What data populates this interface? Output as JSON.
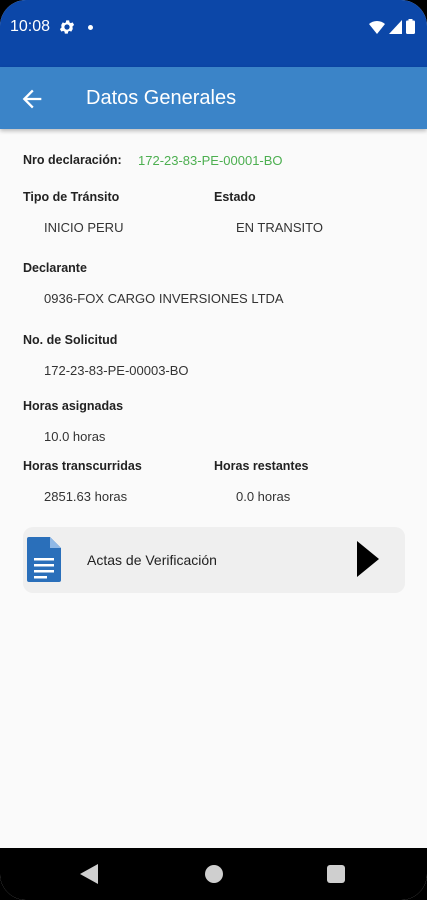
{
  "status_bar": {
    "time": "10:08",
    "icons": [
      "gear-icon",
      "notification-dot-icon",
      "wifi-icon",
      "signal-icon",
      "battery-icon"
    ]
  },
  "app_bar": {
    "title": "Datos Generales",
    "back_icon": "arrow-left-icon"
  },
  "fields": {
    "nro_declaracion": {
      "label": "Nro declaración:",
      "value": "172-23-83-PE-00001-BO"
    },
    "tipo_transito": {
      "label": "Tipo de Tránsito",
      "value": "INICIO PERU"
    },
    "estado": {
      "label": "Estado",
      "value": "EN TRANSITO"
    },
    "declarante": {
      "label": "Declarante",
      "value": "0936-FOX CARGO INVERSIONES LTDA"
    },
    "no_solicitud": {
      "label": "No. de Solicitud",
      "value": "172-23-83-PE-00003-BO"
    },
    "horas_asignadas": {
      "label": "Horas asignadas",
      "value": "10.0 horas"
    },
    "horas_transcurridas": {
      "label": "Horas transcurridas",
      "value": "2851.63 horas"
    },
    "horas_restantes": {
      "label": "Horas restantes",
      "value": "0.0 horas"
    }
  },
  "actas_card": {
    "label": "Actas de Verificación",
    "icon": "document-icon",
    "arrow_icon": "play-arrow-icon"
  },
  "colors": {
    "status_bar": "#0c47a8",
    "app_bar": "#3b84c8",
    "declaration_value": "#4caf50",
    "document_icon": "#2a6fba"
  }
}
